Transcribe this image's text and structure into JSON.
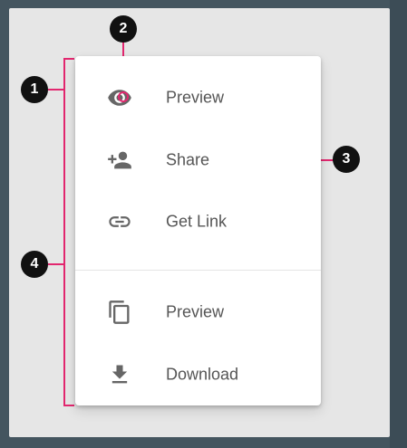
{
  "menu": {
    "items": [
      {
        "label": "Preview",
        "icon": "eye-icon"
      },
      {
        "label": "Share",
        "icon": "person-add-icon"
      },
      {
        "label": "Get Link",
        "icon": "link-icon"
      },
      {
        "label": "Preview",
        "icon": "copy-icon"
      },
      {
        "label": "Download",
        "icon": "download-icon"
      }
    ]
  },
  "callouts": [
    "1",
    "2",
    "3",
    "4"
  ],
  "colors": {
    "annotation_line": "#e2276f",
    "callout_fill": "#111111",
    "menu_background": "#ffffff",
    "frame_background": "#e6e6e6",
    "outer_background": "#44555f",
    "icon_color": "#666666",
    "label_color": "#555555"
  }
}
